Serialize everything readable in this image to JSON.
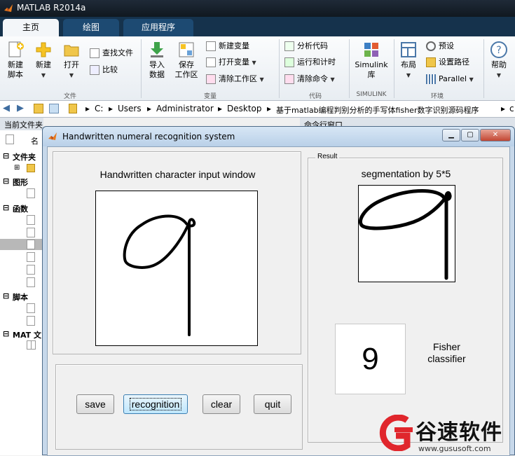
{
  "matlab": {
    "title": "MATLAB R2014a",
    "tabs": [
      {
        "label": "主页"
      },
      {
        "label": "绘图"
      },
      {
        "label": "应用程序"
      }
    ],
    "ribbon": {
      "new_script": "新建\n脚本",
      "new": "新建",
      "open": "打开",
      "find_files": "查找文件",
      "compare": "比较",
      "file_group": "文件",
      "import_data": "导入\n数据",
      "save_workspace": "保存\n工作区",
      "new_variable": "新建变量",
      "open_variable": "打开变量",
      "clear_workspace": "清除工作区",
      "variable_group": "变量",
      "analyze_code": "分析代码",
      "run_and_time": "运行和计时",
      "clear_commands": "清除命令",
      "code_group": "代码",
      "simulink_library": "Simulink\n库",
      "simulink_group": "SIMULINK",
      "layout": "布局",
      "preferences": "预设",
      "set_path": "设置路径",
      "parallel": "Parallel",
      "environment_group": "环境",
      "help": "帮助"
    },
    "address": {
      "parts": [
        "C:",
        "Users",
        "Administrator",
        "Desktop",
        "基于matlab编程判别分析的手写体fisher数字识别源码程序",
        "c"
      ]
    },
    "left_panel": {
      "header": "当前文件夹",
      "col_name": "名",
      "sections": [
        "文件夹",
        "图形",
        "函数",
        "脚本",
        "MAT 文"
      ]
    },
    "command_window": {
      "header": "命令行窗口"
    }
  },
  "figure": {
    "title": "Handwritten numeral recognition system",
    "input_title": "Handwritten character input window",
    "result_panel_label": "Result",
    "segmentation_title": "segmentation by 5*5",
    "result_digit": "9",
    "classifier_label": "Fisher\nclassifier",
    "buttons": {
      "save": "save",
      "recognition": "recognition",
      "clear": "clear",
      "quit": "quit"
    }
  },
  "watermark": {
    "brand": "谷速软件",
    "url": "www.gususoft.com",
    "color": "#e0262c"
  }
}
